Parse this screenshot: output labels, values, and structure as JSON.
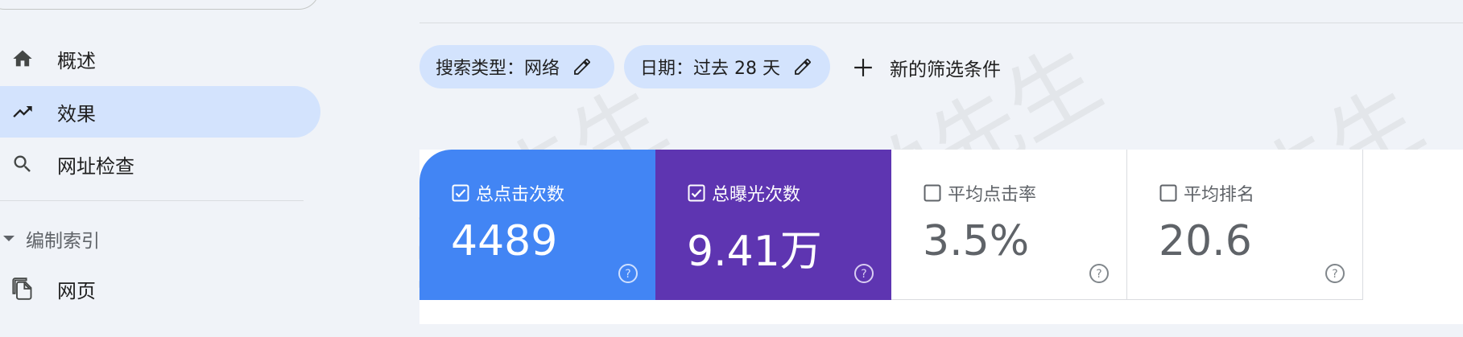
{
  "sidebar": {
    "items": [
      {
        "label": "概述",
        "icon": "home-icon"
      },
      {
        "label": "效果",
        "icon": "trending-up-icon",
        "active": true
      },
      {
        "label": "网址检查",
        "icon": "search-icon"
      }
    ],
    "section": {
      "label": "编制索引",
      "icon": "caret-down-icon"
    },
    "section_items": [
      {
        "label": "网页",
        "icon": "pages-icon"
      }
    ]
  },
  "filters": {
    "search_type": "搜索类型：网络",
    "date": "日期：过去 28 天",
    "add_filter": "新的筛选条件"
  },
  "metrics": [
    {
      "title": "总点击次数",
      "value": "4489",
      "checked": true,
      "color": "#4285f4"
    },
    {
      "title": "总曝光次数",
      "value": "9.41万",
      "checked": true,
      "color": "#5e35b1"
    },
    {
      "title": "平均点击率",
      "value": "3.5%",
      "checked": false,
      "color": "#ffffff"
    },
    {
      "title": "平均排名",
      "value": "20.6",
      "checked": false,
      "color": "#ffffff"
    }
  ],
  "watermark": "图帕先生",
  "colors": {
    "active_nav": "#d3e3fd",
    "chip": "#d3e3fd",
    "page_bg": "#f0f3f8"
  }
}
